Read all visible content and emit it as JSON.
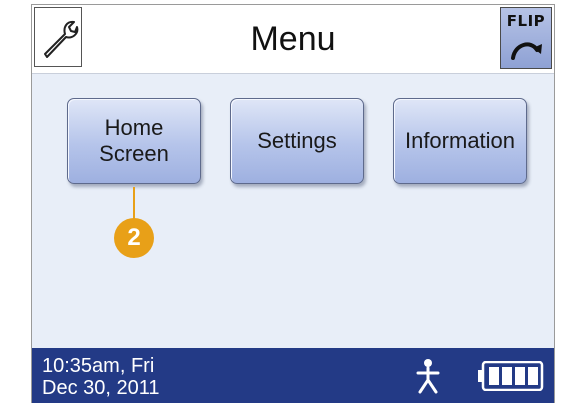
{
  "header": {
    "title": "Menu",
    "tool_icon": "wrench-icon",
    "flip_label": "FLIP",
    "flip_icon": "curved-arrow-icon"
  },
  "menu": {
    "buttons": [
      {
        "label": "Home\nScreen"
      },
      {
        "label": "Settings"
      },
      {
        "label": "Information"
      }
    ]
  },
  "callout": {
    "number": "2",
    "color": "#e8a018"
  },
  "status": {
    "time": "10:35am, Fri",
    "date": "Dec 30, 2011",
    "activity_icon": "person-icon",
    "battery_icon": "battery-icon",
    "battery_level": 1.0
  },
  "colors": {
    "statusbar": "#233a86",
    "button": "#b5c4ea",
    "screen_bg": "#e8eef8"
  }
}
